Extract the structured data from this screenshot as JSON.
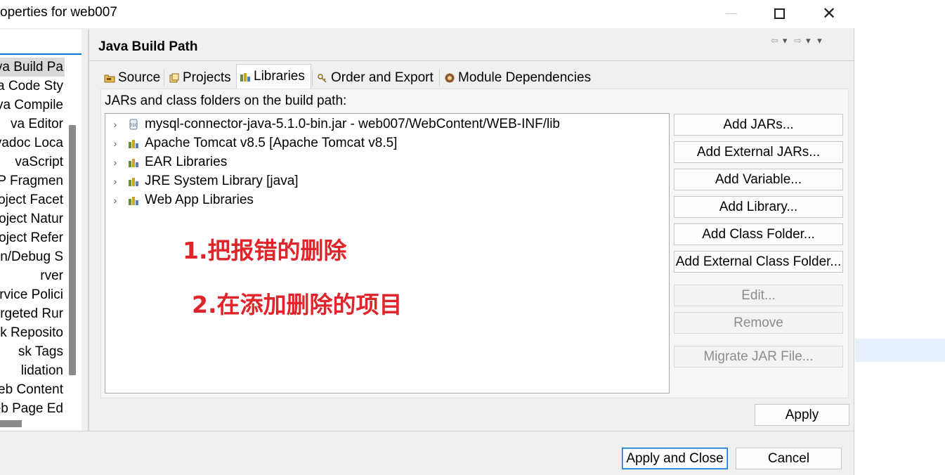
{
  "window": {
    "title": "operties for web007",
    "close_glyph": "✕"
  },
  "sidebar": {
    "items": [
      {
        "label": "va Build Pa",
        "selected": true
      },
      {
        "label": "va Code Sty"
      },
      {
        "label": "va Compile"
      },
      {
        "label": "va Editor"
      },
      {
        "label": "vadoc Loca"
      },
      {
        "label": "vaScript"
      },
      {
        "label": "P Fragmen"
      },
      {
        "label": "oject Facet"
      },
      {
        "label": "oject Natur"
      },
      {
        "label": "oject Refer"
      },
      {
        "label": "un/Debug S"
      },
      {
        "label": "rver"
      },
      {
        "label": "rvice Polici"
      },
      {
        "label": "rgeted Rur"
      },
      {
        "label": "sk Reposito"
      },
      {
        "label": "sk Tags"
      },
      {
        "label": "lidation"
      },
      {
        "label": "eb Content"
      },
      {
        "label": "eb Page Ed"
      }
    ]
  },
  "page": {
    "title": "Java Build Path",
    "nav": {
      "back": "⇦",
      "forward": "⇨",
      "dropdown": "▾"
    }
  },
  "tabs": [
    {
      "label": "Source",
      "icon": "source-folder-icon"
    },
    {
      "label": "Projects",
      "icon": "projects-icon"
    },
    {
      "label": "Libraries",
      "icon": "libraries-icon",
      "active": true
    },
    {
      "label": "Order and Export",
      "icon": "order-export-icon"
    },
    {
      "label": "Module Dependencies",
      "icon": "module-icon"
    }
  ],
  "libraries": {
    "label": "JARs and class folders on the build path:",
    "items": [
      {
        "label": "mysql-connector-java-5.1.0-bin.jar - web007/WebContent/WEB-INF/lib",
        "icon": "jar-icon"
      },
      {
        "label": "Apache Tomcat v8.5 [Apache Tomcat v8.5]",
        "icon": "library-icon"
      },
      {
        "label": "EAR Libraries",
        "icon": "library-icon"
      },
      {
        "label": "JRE System Library [java]",
        "icon": "library-icon"
      },
      {
        "label": "Web App Libraries",
        "icon": "library-icon"
      }
    ],
    "expand_glyph": "›"
  },
  "annotations": {
    "step1": "1.把报错的删除",
    "step2": "2.在添加删除的项目"
  },
  "buttons": {
    "add_jars": "Add JARs...",
    "add_external_jars": "Add External JARs...",
    "add_variable": "Add Variable...",
    "add_library": "Add Library...",
    "add_class_folder": "Add Class Folder...",
    "add_external_class_folder": "Add External Class Folder...",
    "edit": "Edit...",
    "remove": "Remove",
    "migrate_jar": "Migrate JAR File...",
    "apply": "Apply",
    "apply_and_close": "Apply and Close",
    "cancel": "Cancel"
  },
  "colors": {
    "annotation": "#e0242a",
    "focus": "#0078d7"
  }
}
